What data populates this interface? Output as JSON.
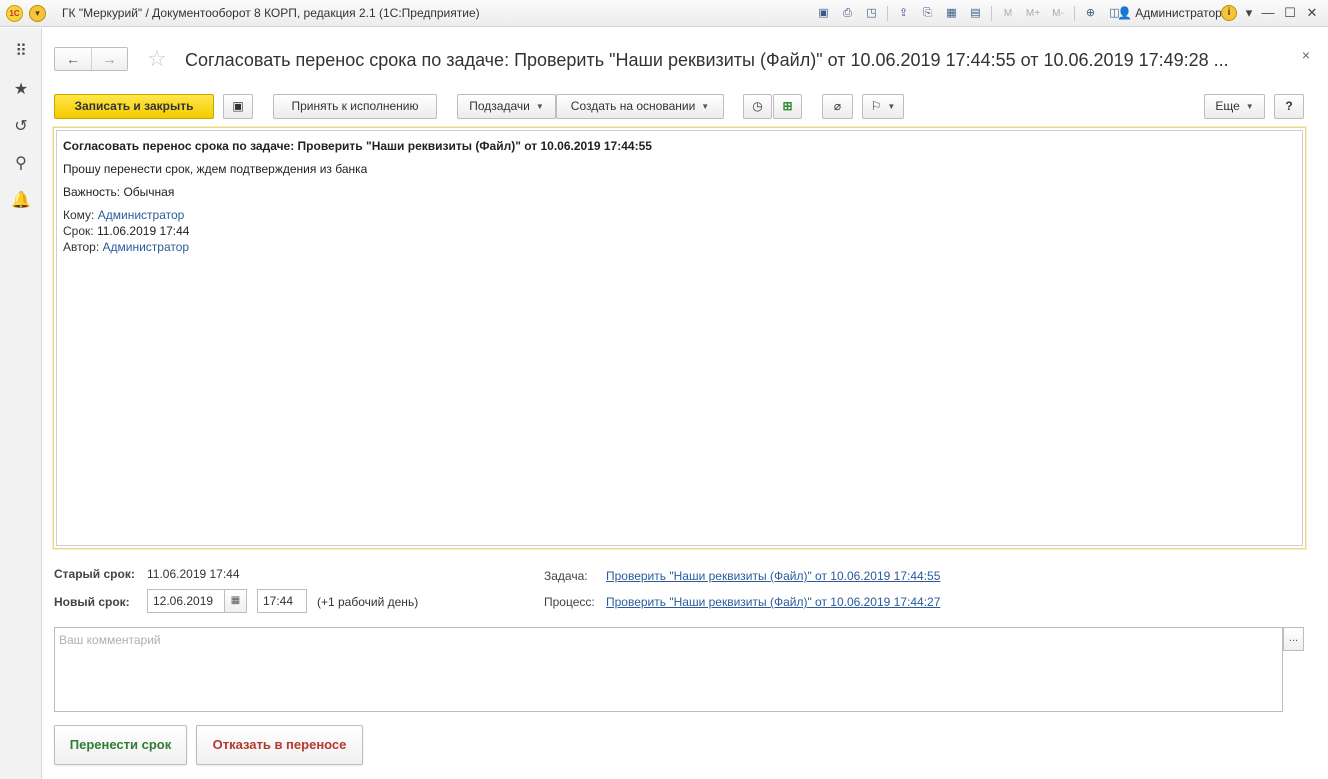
{
  "window": {
    "title": "ГК \"Меркурий\" / Документооборот 8 КОРП, редакция 2.1  (1С:Предприятие)",
    "user": "Администратор",
    "zoom_buttons": [
      "M",
      "M+",
      "M-"
    ]
  },
  "form": {
    "title": "Согласовать перенос срока по задаче: Проверить \"Наши реквизиты (Файл)\" от 10.06.2019 17:44:55 от 10.06.2019 17:49:28 ..."
  },
  "toolbar": {
    "save_close": "Записать и закрыть",
    "accept": "Принять к исполнению",
    "subtasks": "Подзадачи",
    "create_based": "Создать на основании",
    "more": "Еще",
    "help": "?"
  },
  "message": {
    "subject": "Согласовать перенос срока по задаче: Проверить \"Наши реквизиты (Файл)\" от 10.06.2019 17:44:55",
    "body": "Прошу перенести срок, ждем подтверждения из банка",
    "importance_label": "Важность:",
    "importance_value": "Обычная",
    "to_label": "Кому:",
    "to_value": "Администратор",
    "due_label": "Срок:",
    "due_value": "11.06.2019 17:44",
    "author_label": "Автор:",
    "author_value": "Администратор"
  },
  "fields": {
    "old_due_label": "Старый срок:",
    "old_due_value": "11.06.2019 17:44",
    "new_due_label": "Новый срок:",
    "new_due_date": "12.06.2019",
    "new_due_time": "17:44",
    "new_due_note": "(+1 рабочий день)",
    "task_label": "Задача:",
    "task_link": "Проверить \"Наши реквизиты (Файл)\" от 10.06.2019 17:44:55",
    "process_label": "Процесс:",
    "process_link": "Проверить \"Наши реквизиты (Файл)\" от 10.06.2019 17:44:27"
  },
  "comment": {
    "placeholder": "Ваш комментарий",
    "more_button": "..."
  },
  "actions": {
    "approve": "Перенести срок",
    "approve_color": "#2e7d32",
    "reject": "Отказать в переносе",
    "reject_color": "#b23a2e"
  }
}
